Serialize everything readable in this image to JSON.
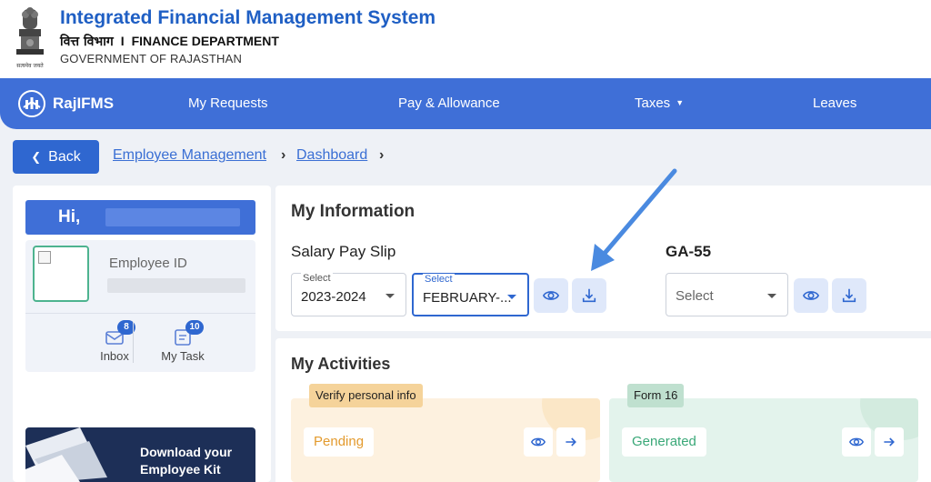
{
  "header": {
    "title": "Integrated Financial Management System",
    "dept_hindi": "वित्त विभाग",
    "dept_separator": "I",
    "dept_english": "FINANCE DEPARTMENT",
    "government": "GOVERNMENT OF RAJASTHAN",
    "emblem_caption": "सत्यमेव जयते"
  },
  "navbar": {
    "brand": "RajIFMS",
    "items": [
      {
        "label": "My Requests"
      },
      {
        "label": "Pay & Allowance"
      },
      {
        "label": "Taxes",
        "has_dropdown": true
      },
      {
        "label": "Leaves"
      }
    ]
  },
  "breadcrumb": {
    "back_label": "Back",
    "items": [
      "Employee Management",
      "Dashboard"
    ]
  },
  "profile": {
    "greeting": "Hi,",
    "employee_id_label": "Employee ID",
    "quick_actions": [
      {
        "label": "Inbox",
        "badge": "8",
        "icon": "inbox-icon"
      },
      {
        "label": "My Task",
        "badge": "10",
        "icon": "task-icon"
      }
    ],
    "kit_banner": "Download your Employee Kit"
  },
  "my_information": {
    "title": "My Information",
    "salary_slip": {
      "title": "Salary Pay Slip",
      "year_label": "Select",
      "year_value": "2023-2024",
      "month_label": "Select",
      "month_value": "FEBRUARY-..."
    },
    "ga55": {
      "title": "GA-55",
      "placeholder": "Select"
    }
  },
  "my_activities": {
    "title": "My Activities",
    "cards": [
      {
        "tag": "Verify personal info",
        "status": "Pending",
        "color": "#e39a2d"
      },
      {
        "tag": "Form 16",
        "status": "Generated",
        "color": "#3aa878"
      }
    ]
  },
  "colors": {
    "primary": "#3f6fd7",
    "accent_button": "#2f67d0",
    "title_blue": "#1f5fc4",
    "annotation_arrow": "#4a8ae0"
  }
}
